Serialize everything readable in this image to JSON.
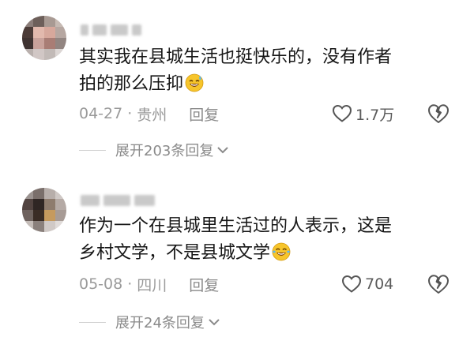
{
  "comments": [
    {
      "text_line1": "其实我在县城生活也挺快乐的，没有作者",
      "text_line2": "拍的那么压抑",
      "emoji": "sweat-smile-emoji",
      "date": "04-27",
      "separator": "·",
      "location": "贵州",
      "reply_label": "回复",
      "likes": "1.7万",
      "expand_label": "展开203条回复"
    },
    {
      "text_line1": "作为一个在县城里生活过的人表示，这是",
      "text_line2": "乡村文学，不是县城文学",
      "emoji": "tears-of-joy-emoji",
      "date": "05-08",
      "separator": "·",
      "location": "四川",
      "reply_label": "回复",
      "likes": "704",
      "expand_label": "展开24条回复"
    }
  ],
  "colors": {
    "text": "#161616",
    "meta": "#9a9a9a",
    "icon": "#555555",
    "emoji_face": "#f7c52b"
  }
}
